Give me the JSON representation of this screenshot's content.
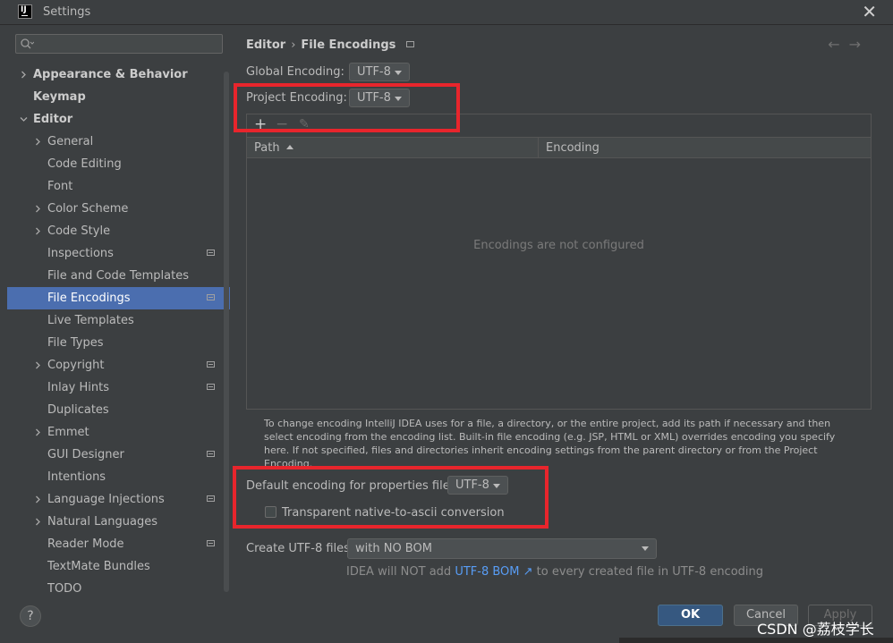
{
  "window": {
    "logo_text": "IJ",
    "title": "Settings",
    "close_glyph": "✕"
  },
  "search": {
    "placeholder": ""
  },
  "sidebar": {
    "items": [
      {
        "label": "Appearance & Behavior",
        "bold": true,
        "chevron": "right"
      },
      {
        "label": "Keymap",
        "bold": true
      },
      {
        "label": "Editor",
        "bold": true,
        "chevron": "down"
      },
      {
        "label": "General",
        "chevron": "right"
      },
      {
        "label": "Code Editing"
      },
      {
        "label": "Font"
      },
      {
        "label": "Color Scheme",
        "chevron": "right"
      },
      {
        "label": "Code Style",
        "chevron": "right"
      },
      {
        "label": "Inspections",
        "project_icon": true
      },
      {
        "label": "File and Code Templates"
      },
      {
        "label": "File Encodings",
        "project_icon": true,
        "selected": true
      },
      {
        "label": "Live Templates"
      },
      {
        "label": "File Types"
      },
      {
        "label": "Copyright",
        "chevron": "right",
        "project_icon": true
      },
      {
        "label": "Inlay Hints",
        "project_icon": true
      },
      {
        "label": "Duplicates"
      },
      {
        "label": "Emmet",
        "chevron": "right"
      },
      {
        "label": "GUI Designer",
        "project_icon": true
      },
      {
        "label": "Intentions"
      },
      {
        "label": "Language Injections",
        "chevron": "right",
        "project_icon": true
      },
      {
        "label": "Natural Languages",
        "chevron": "right"
      },
      {
        "label": "Reader Mode",
        "project_icon": true
      },
      {
        "label": "TextMate Bundles"
      },
      {
        "label": "TODO"
      }
    ]
  },
  "breadcrumb": {
    "parent": "Editor",
    "separator": "›",
    "current": "File Encodings"
  },
  "nav": {
    "back": "←",
    "forward": "→"
  },
  "settings": {
    "global_label": "Global Encoding:",
    "global_value": "UTF-8",
    "project_label": "Project Encoding:",
    "project_value": "UTF-8",
    "properties_label": "Default encoding for properties files:",
    "properties_value": "UTF-8",
    "transparent_label": "Transparent native-to-ascii conversion",
    "create_label": "Create UTF-8 files:",
    "create_value": "with NO BOM"
  },
  "toolbar": {
    "add": "+",
    "remove": "−",
    "edit": "✎"
  },
  "table": {
    "columns": [
      "Path",
      "Encoding"
    ],
    "empty_text": "Encodings are not configured"
  },
  "help_text": "To change encoding IntelliJ IDEA uses for a file, a directory, or the entire project, add its path if necessary and then select encoding from the encoding list. Built-in file encoding (e.g. JSP, HTML or XML) overrides encoding you specify here. If not specified, files and directories inherit encoding settings from the parent directory or from the Project Encoding.",
  "hint": {
    "before": "IDEA will NOT add ",
    "link": "UTF-8 BOM",
    "link_arrow": "↗",
    "after": " to every created file in UTF-8 encoding"
  },
  "footer": {
    "help": "?",
    "ok": "OK",
    "cancel": "Cancel",
    "apply": "Apply"
  },
  "watermark": "CSDN @荔枝学长",
  "colors": {
    "background": "#3c3f41",
    "selection": "#4b6eaf",
    "highlight_box": "#e8252c",
    "ok_button": "#365880",
    "link": "#589df6"
  }
}
